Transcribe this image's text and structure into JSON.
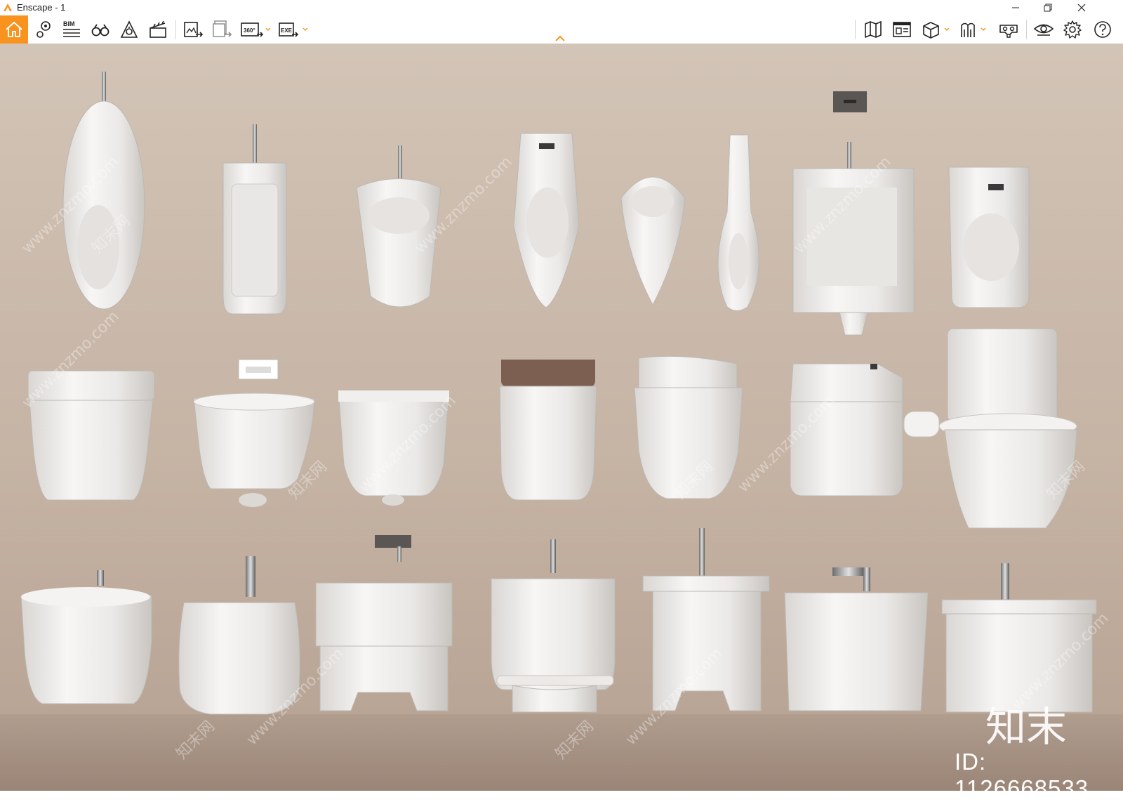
{
  "window": {
    "title": "Enscape - 1",
    "controls": [
      "minimize-icon",
      "restore-icon",
      "close-icon"
    ]
  },
  "toolbar": {
    "left": [
      {
        "name": "home-icon",
        "accent": "#f7931e"
      },
      {
        "name": "location-pin-icon"
      },
      {
        "name": "bim-icon",
        "label": "BIM"
      },
      {
        "name": "binoculars-icon"
      },
      {
        "name": "sun-atmosphere-icon"
      },
      {
        "name": "clapperboard-icon"
      },
      {
        "name": "render-image-icon"
      },
      {
        "name": "batch-render-icon"
      },
      {
        "name": "panorama-360-icon",
        "label": "360°"
      },
      {
        "name": "export-exe-icon",
        "label": "EXE"
      }
    ],
    "right": [
      {
        "name": "map-icon"
      },
      {
        "name": "billboard-icon"
      },
      {
        "name": "cube-view-icon"
      },
      {
        "name": "asset-library-icon"
      },
      {
        "name": "vr-headset-icon"
      },
      {
        "name": "eye-visual-settings-icon"
      },
      {
        "name": "gear-icon"
      },
      {
        "name": "help-icon"
      }
    ],
    "collapse": "chevron-up-icon"
  },
  "viewport": {
    "watermark_url": "www.znzmo.com",
    "watermark_cn": "知末网",
    "brand_mark": "知末",
    "image_id": "ID: 1126668533",
    "wall_color": "#c8b7a8",
    "floor_color": "#a79385"
  }
}
